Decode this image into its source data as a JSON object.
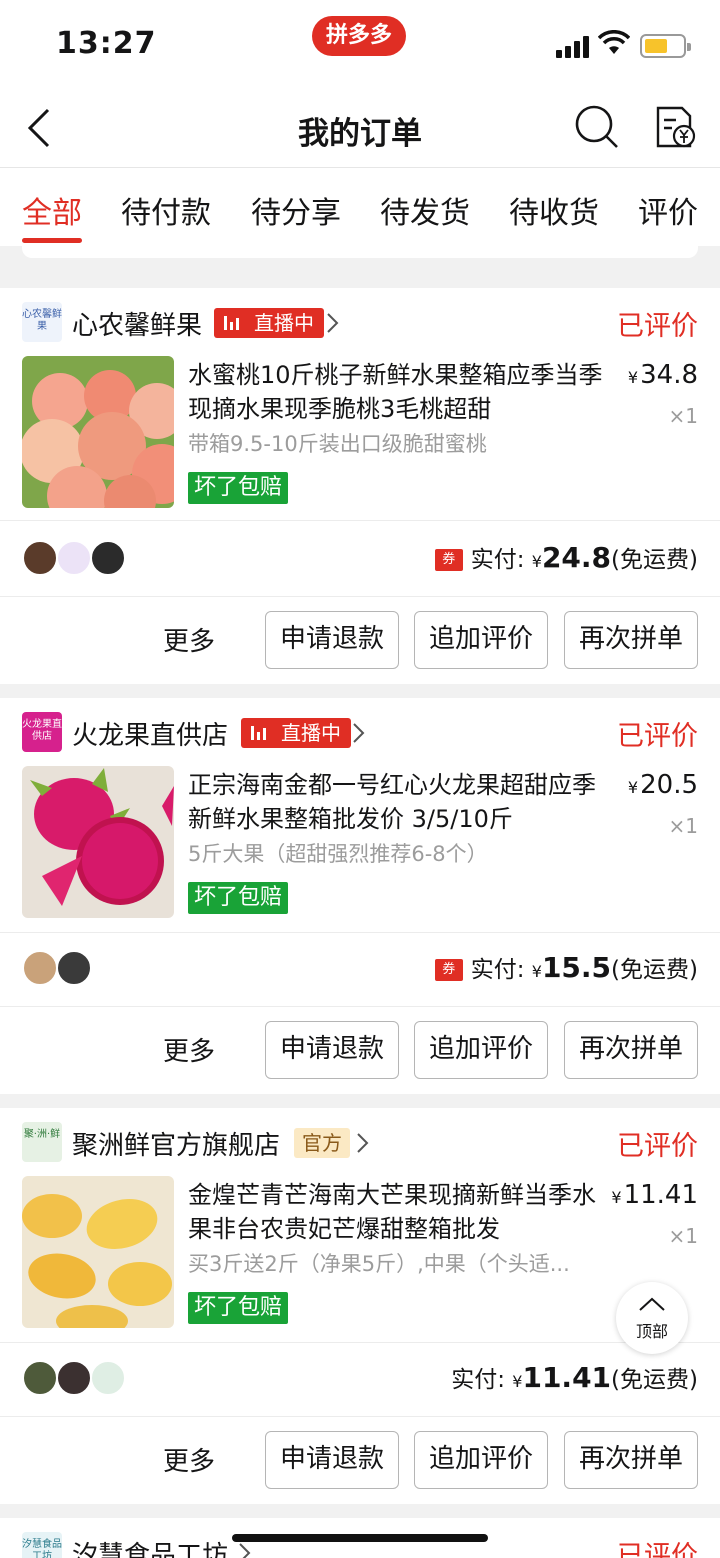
{
  "status_bar": {
    "time": "13:27",
    "app_badge": "拼多多"
  },
  "nav": {
    "title": "我的订单"
  },
  "tabs": [
    "全部",
    "待付款",
    "待分享",
    "待发货",
    "待收货",
    "评价"
  ],
  "orders": [
    {
      "shop": {
        "logo_text": "心农馨鲜果",
        "name": "心农馨鲜果",
        "tag": "直播中"
      },
      "status": "已评价",
      "product": {
        "title": "水蜜桃10斤桃子新鲜水果整箱应季当季现摘水果现季脆桃3毛桃超甜",
        "spec": "带箱9.5-10斤装出口级脆甜蜜桃",
        "guarantee": "坏了包赔",
        "price": "34.8",
        "qty": "×1"
      },
      "paid": {
        "label": "实付:",
        "amount": "24.8",
        "shipping": "(免运费)",
        "coupon": "券"
      }
    },
    {
      "shop": {
        "logo_text": "火龙果直供店",
        "name": "火龙果直供店",
        "tag": "直播中"
      },
      "status": "已评价",
      "product": {
        "title": "正宗海南金都一号红心火龙果超甜应季新鲜水果整箱批发价 3/5/10斤",
        "spec": "5斤大果（超甜强烈推荐6-8个）",
        "guarantee": "坏了包赔",
        "price": "20.5",
        "qty": "×1"
      },
      "paid": {
        "label": "实付:",
        "amount": "15.5",
        "shipping": "(免运费)",
        "coupon": "券"
      }
    },
    {
      "shop": {
        "logo_text": "聚·洲·鲜",
        "name": "聚洲鲜官方旗舰店",
        "tag": "官方"
      },
      "status": "已评价",
      "product": {
        "title": "金煌芒青芒海南大芒果现摘新鲜当季水果非台农贵妃芒爆甜整箱批发",
        "spec": "买3斤送2斤（净果5斤）,中果（个头适...",
        "guarantee": "坏了包赔",
        "price": "11.41",
        "qty": "×1"
      },
      "paid": {
        "label": "实付:",
        "amount": "11.41",
        "shipping": "(免运费)"
      }
    },
    {
      "shop": {
        "logo_text": "汐慧食品工坊",
        "name": "汐慧食品工坊"
      },
      "status": "已评价"
    }
  ],
  "actions": {
    "more": "更多",
    "refund": "申请退款",
    "review": "追加评价",
    "rebuy": "再次拼单"
  },
  "back_to_top": "顶部",
  "currency": "¥",
  "colors": {
    "brand_red": "#e02e24",
    "guarantee_green": "#19a337"
  }
}
